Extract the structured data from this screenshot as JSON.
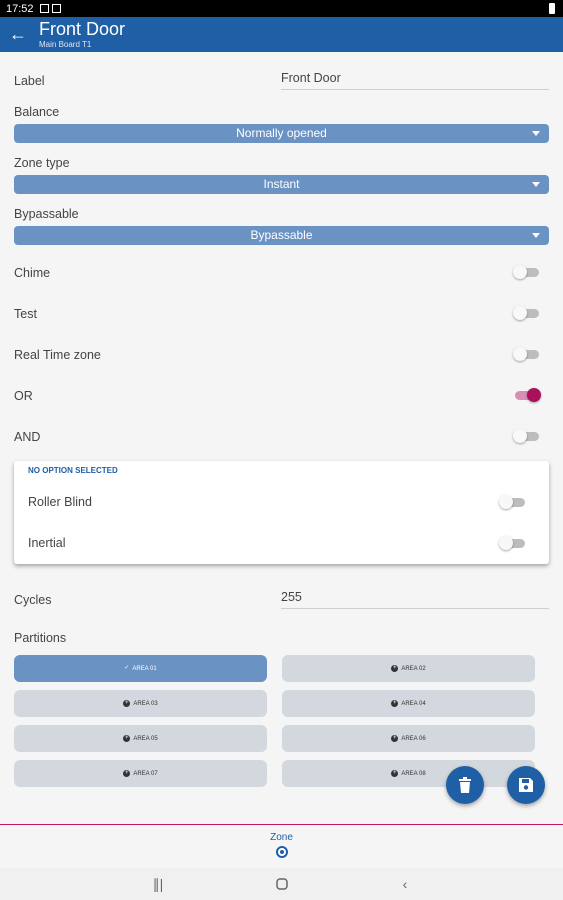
{
  "status_bar": {
    "time": "17:52"
  },
  "app_bar": {
    "title": "Front Door",
    "subtitle": "Main Board T1"
  },
  "form": {
    "label": {
      "label": "Label",
      "value": "Front Door"
    },
    "balance": {
      "label": "Balance",
      "value": "Normally opened"
    },
    "zone_type": {
      "label": "Zone type",
      "value": "Instant"
    },
    "bypassable": {
      "label": "Bypassable",
      "value": "Bypassable"
    },
    "toggles": [
      {
        "label": "Chime",
        "on": false
      },
      {
        "label": "Test",
        "on": false
      },
      {
        "label": "Real Time zone",
        "on": false
      },
      {
        "label": "OR",
        "on": true
      },
      {
        "label": "AND",
        "on": false
      }
    ],
    "option_card": {
      "title": "NO OPTION SELECTED",
      "items": [
        {
          "label": "Roller Blind",
          "on": false
        },
        {
          "label": "Inertial",
          "on": false
        }
      ]
    },
    "cycles": {
      "label": "Cycles",
      "value": "255"
    },
    "partitions": {
      "label": "Partitions",
      "areas": [
        {
          "label": "AREA 01",
          "selected": true
        },
        {
          "label": "AREA 02",
          "selected": false
        },
        {
          "label": "AREA 03",
          "selected": false
        },
        {
          "label": "AREA 04",
          "selected": false
        },
        {
          "label": "AREA 05",
          "selected": false
        },
        {
          "label": "AREA 06",
          "selected": false
        },
        {
          "label": "AREA 07",
          "selected": false
        },
        {
          "label": "AREA 08",
          "selected": false
        }
      ]
    }
  },
  "bottom_nav": {
    "tab_label": "Zone"
  },
  "icons": {
    "back": "arrow-left-icon",
    "delete": "trash-icon",
    "save": "floppy-disk-icon",
    "recents": "recents-icon",
    "home": "home-icon",
    "nav_back": "chevron-left-icon"
  },
  "colors": {
    "primary": "#1e5fa6",
    "dropdown": "#6a93c4",
    "toggle_on": "#a8125d",
    "area_unselected": "#d2d8de",
    "divider": "#c2185b"
  }
}
